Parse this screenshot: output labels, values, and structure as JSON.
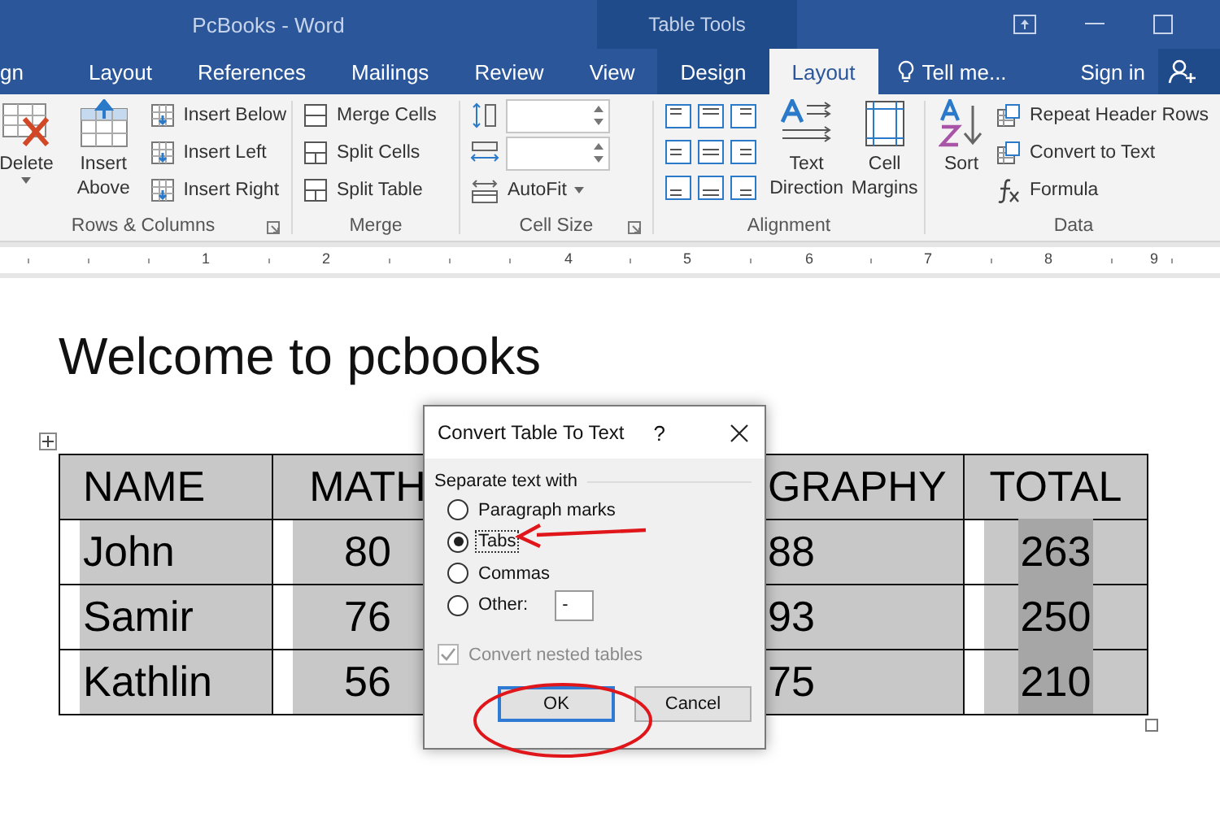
{
  "window": {
    "title": "PcBooks - Word",
    "context_title": "Table Tools"
  },
  "tabs": [
    {
      "label": "gn",
      "selected": false,
      "context": false
    },
    {
      "label": "Layout",
      "selected": false,
      "context": false
    },
    {
      "label": "References",
      "selected": false,
      "context": false
    },
    {
      "label": "Mailings",
      "selected": false,
      "context": false
    },
    {
      "label": "Review",
      "selected": false,
      "context": false
    },
    {
      "label": "View",
      "selected": false,
      "context": false
    },
    {
      "label": "Design",
      "selected": false,
      "context": true
    },
    {
      "label": "Layout",
      "selected": true,
      "context": true
    }
  ],
  "tell_me": "Tell me...",
  "sign_in": "Sign in",
  "ribbon": {
    "rows_columns": {
      "label": "Rows & Columns",
      "delete": "Delete",
      "insert_above": "Insert Above",
      "items": [
        "Insert Below",
        "Insert Left",
        "Insert Right"
      ]
    },
    "merge": {
      "label": "Merge",
      "items": [
        "Merge Cells",
        "Split Cells",
        "Split Table"
      ]
    },
    "cell_size": {
      "label": "Cell Size",
      "autofit": "AutoFit"
    },
    "alignment": {
      "label": "Alignment",
      "text_direction": "Text Direction",
      "cell_margins": "Cell Margins"
    },
    "data": {
      "label": "Data",
      "sort": "Sort",
      "items": [
        "Repeat Header Rows",
        "Convert to Text",
        "Formula"
      ]
    }
  },
  "ruler": {
    "marks": [
      "1",
      "2",
      "4",
      "5",
      "6",
      "7",
      "8",
      "9"
    ]
  },
  "document": {
    "heading": "Welcome to pcbooks",
    "table": {
      "header": [
        "NAME",
        "MATH",
        "GRAPHY",
        "TOTAL"
      ],
      "rows": [
        [
          "John",
          "80",
          "88",
          "263"
        ],
        [
          "Samir",
          "76",
          "93",
          "250"
        ],
        [
          "Kathlin",
          "56",
          "75",
          "210"
        ]
      ]
    }
  },
  "dialog": {
    "title": "Convert Table To Text",
    "help": "?",
    "group_label": "Separate text with",
    "options": [
      {
        "label": "Paragraph marks",
        "selected": false
      },
      {
        "label": "Tabs",
        "selected": true
      },
      {
        "label": "Commas",
        "selected": false
      },
      {
        "label": "Other:",
        "selected": false,
        "field": "-"
      }
    ],
    "nested": {
      "label": "Convert nested tables",
      "checked": true,
      "disabled": true
    },
    "buttons": [
      {
        "label": "OK",
        "default": true
      },
      {
        "label": "Cancel",
        "default": false
      }
    ]
  }
}
